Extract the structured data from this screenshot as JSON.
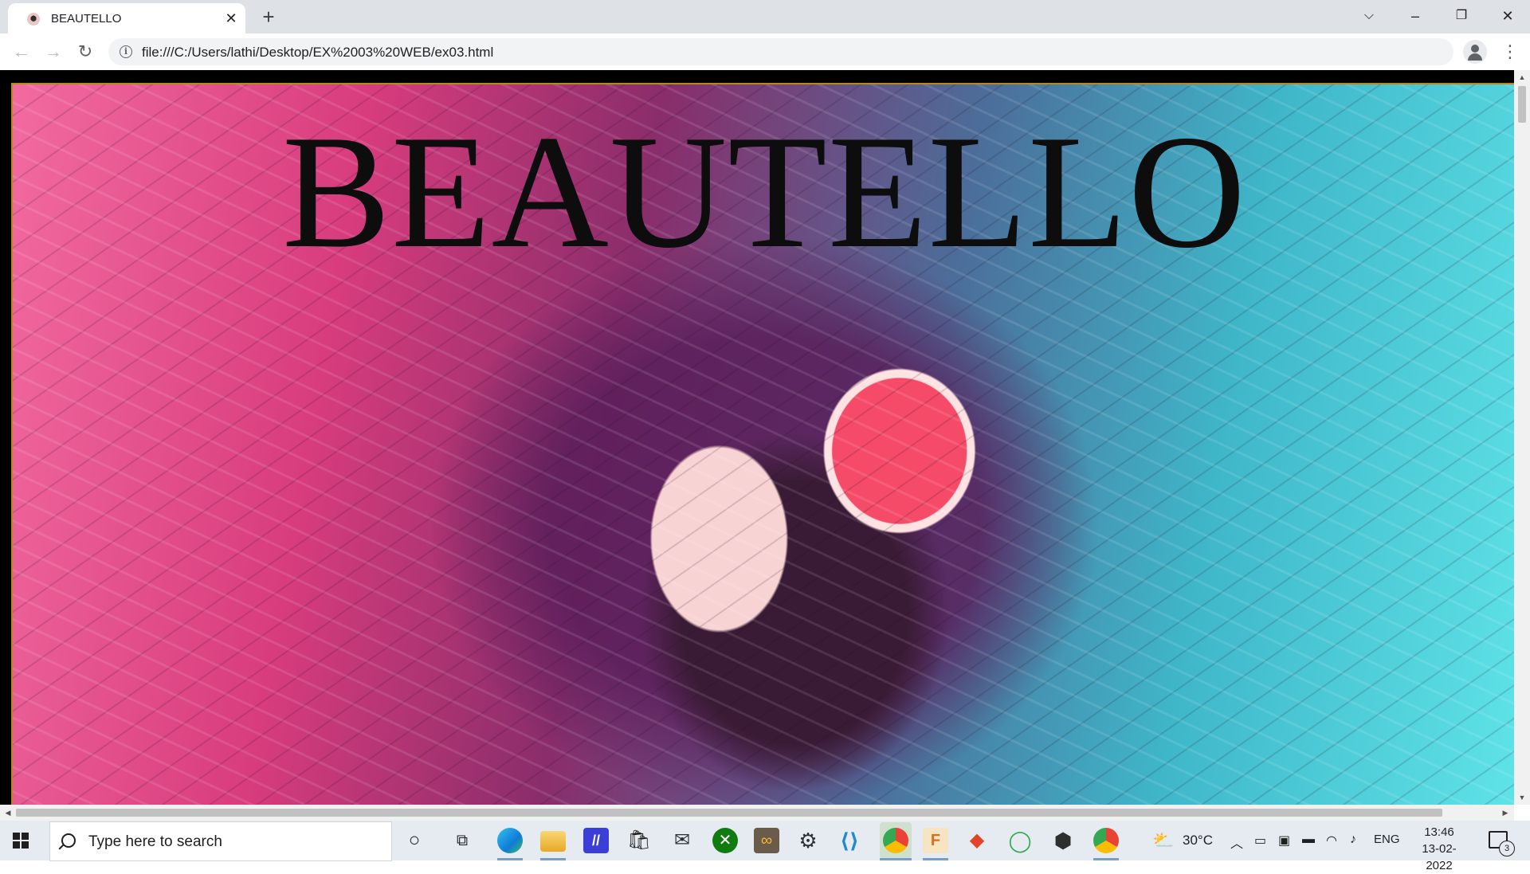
{
  "browser": {
    "tab_title": "BEAUTELLO",
    "tab_close": "✕",
    "new_tab": "+",
    "url": "file:///C:/Users/lathi/Desktop/EX%2003%20WEB/ex03.html",
    "menu": "⋮"
  },
  "page": {
    "heading": "BEAUTELLO",
    "hero_image": "woman-with-grapefruit-and-flowing-hair"
  },
  "taskbar": {
    "search_placeholder": "Type here to search",
    "pinned_icons": [
      "cortana-icon",
      "task-view-icon",
      "edge-icon",
      "file-explorer-icon",
      "app-icon",
      "store-icon",
      "mail-icon",
      "xbox-icon",
      "infinity-app-icon",
      "settings-icon",
      "vscode-icon",
      "chrome-icon",
      "app-f-icon",
      "git-icon",
      "refresh-app-icon",
      "unity-icon",
      "chrome-icon"
    ],
    "weather": "30°C",
    "language": "ENG",
    "time": "13:46",
    "date": "13-02-2022",
    "notification_count": "3"
  },
  "colors": {
    "tabstrip": "#dee1e6",
    "taskbar": "#e6eaf1",
    "hero_pink": "#f26b9f",
    "hero_cyan": "#5fe3e8"
  }
}
